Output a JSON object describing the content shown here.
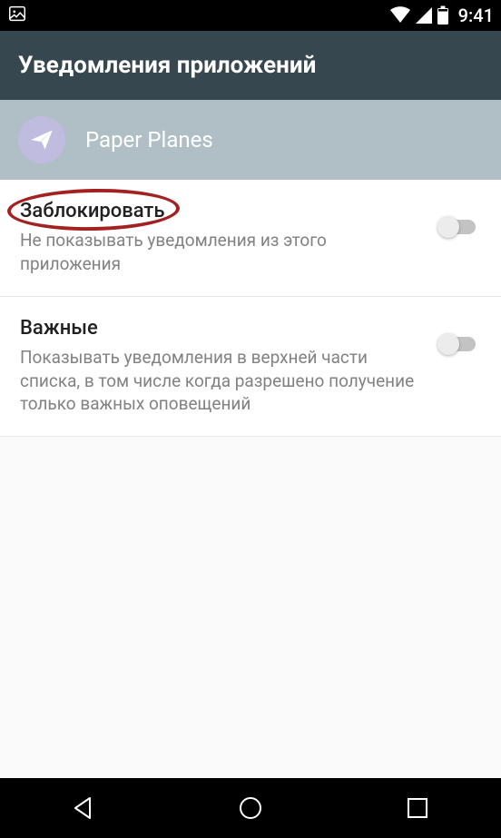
{
  "statusbar": {
    "time": "9:41"
  },
  "header": {
    "title": "Уведомления приложений"
  },
  "app": {
    "name": "Paper Planes"
  },
  "settings": [
    {
      "title": "Заблокировать",
      "desc": "Не показывать уведомления из этого приложения",
      "toggled": false,
      "highlighted": true
    },
    {
      "title": "Важные",
      "desc": "Показывать уведомления в верхней части списка, в том числе когда разрешено получение только важных оповещений",
      "toggled": false,
      "highlighted": false
    }
  ]
}
